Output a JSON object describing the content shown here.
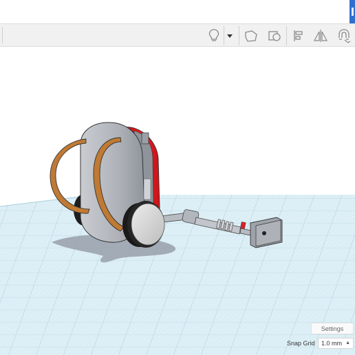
{
  "toolbar": {
    "buttons": [
      {
        "name": "light-bulb-icon"
      },
      {
        "name": "dropdown-arrow-icon"
      },
      {
        "name": "note-shape-icon"
      },
      {
        "name": "view-shape-icon"
      },
      {
        "name": "align-icon"
      },
      {
        "name": "mirror-icon"
      },
      {
        "name": "magnet-icon"
      }
    ]
  },
  "viewport": {
    "settings_label": "Settings",
    "snap_grid_label": "Snap Grid",
    "snap_grid_value": "1.0 mm",
    "grid_color": "#9ec7d8",
    "plane_color": "#d9eef6"
  },
  "colors": {
    "accent": "#2f6fce",
    "red": "#e3191e",
    "body_gray": "#a9adb4",
    "strap_brown": "#b8702c"
  }
}
